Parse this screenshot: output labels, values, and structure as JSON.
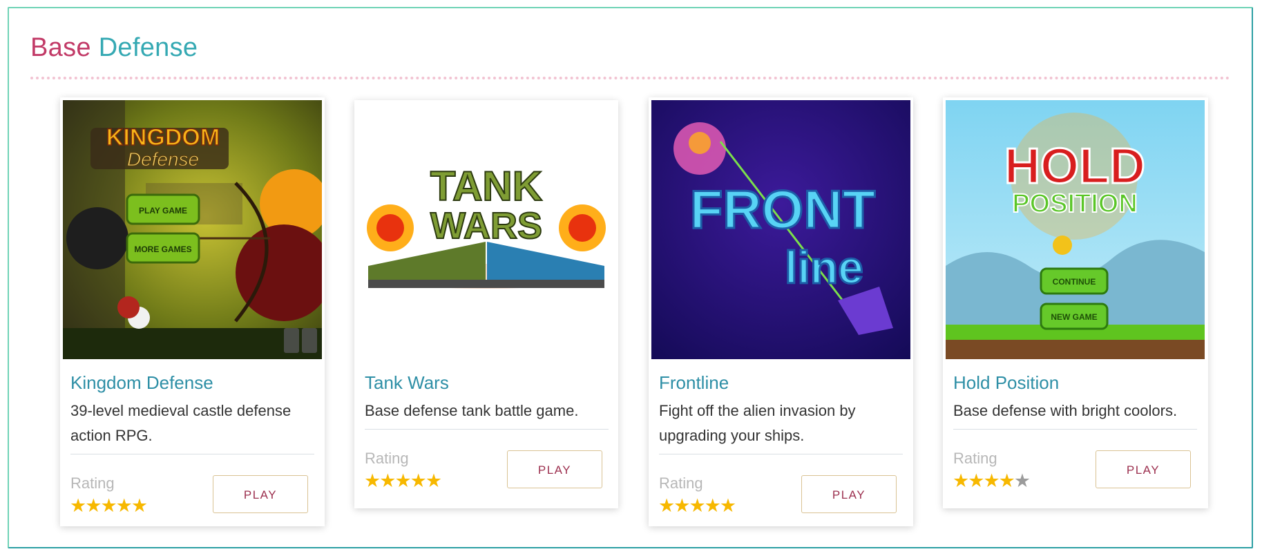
{
  "section": {
    "title_word1": "Base",
    "title_word2": "Defense"
  },
  "games": [
    {
      "title": "Kingdom Defense",
      "description": "39-level medieval castle defense action RPG.",
      "rating_label": "Rating",
      "rating": 5,
      "play_label": "PLAY",
      "thumb_text": {
        "line1": "KINGDOM",
        "line2": "Defense",
        "btn1": "PLAY GAME",
        "btn2": "MORE GAMES"
      }
    },
    {
      "title": "Tank Wars",
      "description": "Base defense tank battle game.",
      "rating_label": "Rating",
      "rating": 5,
      "play_label": "PLAY",
      "thumb_text": {
        "line1": "TANK",
        "line2": "WARS"
      }
    },
    {
      "title": "Frontline",
      "description": "Fight off the alien invasion by upgrading your ships.",
      "rating_label": "Rating",
      "rating": 5,
      "play_label": "PLAY",
      "thumb_text": {
        "line1": "FRONT",
        "line2": "line"
      }
    },
    {
      "title": "Hold Position",
      "description": "Base defense with bright coolors.",
      "rating_label": "Rating",
      "rating": 4,
      "play_label": "PLAY",
      "thumb_text": {
        "line1": "HOLD",
        "line2": "POSITION",
        "btn1": "CONTINUE",
        "btn2": "NEW GAME"
      }
    }
  ],
  "colors": {
    "title_pink": "#c23a67",
    "title_teal": "#35a9b3",
    "card_title": "#2e8fa6",
    "star": "#f7b800",
    "play_text": "#9c2f4e"
  }
}
